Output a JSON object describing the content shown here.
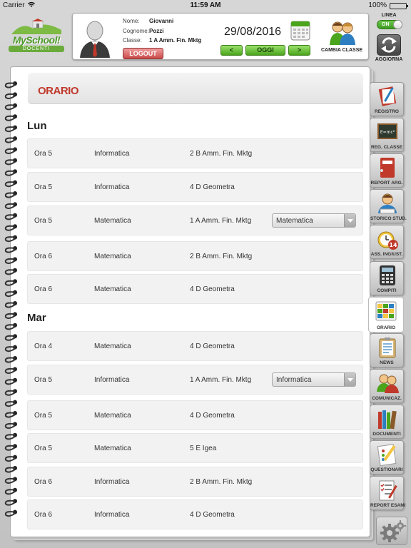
{
  "status": {
    "carrier": "Carrier",
    "time": "11:59 AM",
    "battery": "100%"
  },
  "logo": {
    "brand": "MySchool!",
    "sub": "DOCENTI"
  },
  "user": {
    "labels": {
      "nome": "Nome:",
      "cognome": "Cognome:",
      "classe": "Classe:"
    },
    "nome": "Giovanni",
    "cognome": "Pozzi",
    "classe": "1 A Amm. Fin. Mktg",
    "logout": "LOGOUT"
  },
  "date": {
    "value": "29/08/2016",
    "prev": "<",
    "today": "OGGI",
    "next": ">"
  },
  "cambia_classe": "CAMBIA CLASSE",
  "linea": {
    "label": "LINEA",
    "toggle": "ON"
  },
  "aggiorna": "AGGIORNA",
  "page_title": "ORARIO",
  "days": [
    {
      "name": "Lun",
      "rows": [
        {
          "ora": "Ora 5",
          "materia": "Informatica",
          "classe": "2 B Amm. Fin. Mktg",
          "select": ""
        },
        {
          "ora": "Ora 5",
          "materia": "Informatica",
          "classe": "4 D Geometra",
          "select": ""
        },
        {
          "ora": "Ora 5",
          "materia": "Matematica",
          "classe": "1 A Amm. Fin. Mktg",
          "select": "Matematica"
        },
        {
          "ora": "Ora 6",
          "materia": "Matematica",
          "classe": "2 B Amm. Fin. Mktg",
          "select": ""
        },
        {
          "ora": "Ora 6",
          "materia": "Matematica",
          "classe": "4 D Geometra",
          "select": ""
        }
      ]
    },
    {
      "name": "Mar",
      "rows": [
        {
          "ora": "Ora 4",
          "materia": "Matematica",
          "classe": "4 D Geometra",
          "select": ""
        },
        {
          "ora": "Ora 5",
          "materia": "Informatica",
          "classe": "1 A Amm. Fin. Mktg",
          "select": "Informatica"
        },
        {
          "ora": "Ora 5",
          "materia": "Matematica",
          "classe": "4 D Geometra",
          "select": ""
        },
        {
          "ora": "Ora 5",
          "materia": "Matematica",
          "classe": "5 E Igea",
          "select": ""
        },
        {
          "ora": "Ora 6",
          "materia": "Informatica",
          "classe": "2 B Amm. Fin. Mktg",
          "select": ""
        },
        {
          "ora": "Ora 6",
          "materia": "Informatica",
          "classe": "4 D Geometra",
          "select": ""
        }
      ]
    }
  ],
  "menu": [
    {
      "label": "REGISTRO",
      "icon": "register-book-icon"
    },
    {
      "label": "REG. CLASSE",
      "icon": "blackboard-icon"
    },
    {
      "label": "REPORT ARG.",
      "icon": "red-binder-icon"
    },
    {
      "label": "STORICO STUD.",
      "icon": "student-history-icon"
    },
    {
      "label": "ASS. INGIUST.",
      "icon": "alarm-clock-icon",
      "badge": "14"
    },
    {
      "label": "COMPITI",
      "icon": "calculator-icon"
    },
    {
      "label": "ORARIO",
      "icon": "timetable-icon",
      "active": true
    },
    {
      "label": "NEWS",
      "icon": "news-clipboard-icon"
    },
    {
      "label": "COMUNICAZ.",
      "icon": "communications-icon"
    },
    {
      "label": "DOCUMENTI",
      "icon": "books-icon"
    },
    {
      "label": "QUESTIONARI",
      "icon": "questionnaire-icon"
    },
    {
      "label": "REPORT ESAMI",
      "icon": "exam-report-icon"
    }
  ],
  "colors": {
    "accent_green": "#4aa51d",
    "title_red": "#c0392b",
    "logout_red": "#c94a4a"
  }
}
